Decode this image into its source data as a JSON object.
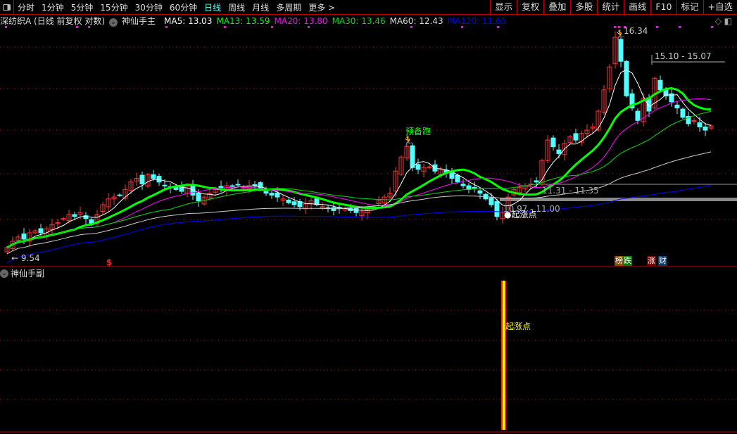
{
  "topbar": {
    "periods": [
      "分时",
      "1分钟",
      "5分钟",
      "15分钟",
      "30分钟",
      "60分钟",
      "日线",
      "周线",
      "月线",
      "多周期",
      "更多 >"
    ],
    "active": "日线",
    "buttons": [
      "显示",
      "复权",
      "叠加",
      "多股",
      "统计",
      "画线",
      "F10",
      "标记",
      "+自选"
    ]
  },
  "info": {
    "stock": "深纺织A (日线 前复权 对数)",
    "indicator": "神仙手主",
    "ma5": "MA5: 13.03",
    "ma13": "MA13: 13.59",
    "ma20": "MA20: 13.80",
    "ma30": "MA30: 13.46",
    "ma60": "MA60: 12.43",
    "ma120": "MA120: 11.65"
  },
  "colors": {
    "up": "#ff3232",
    "down": "#54ffff",
    "ma5": "#ffffff",
    "ma13": "#00ff00",
    "ma20": "#ff00ff",
    "ma30": "#00dd00",
    "ma60": "#cccccc",
    "ma120": "#0000ff",
    "grid": "#c00000"
  },
  "annotations": {
    "ready": "预备跑",
    "high": "16.34",
    "range1": "15.10 - 15.07",
    "range2": "11.31 - 11.35",
    "range3": "10.97 - 11.00",
    "start": "●起涨点",
    "low": "9.54",
    "dollar": "$",
    "tags": [
      "榜",
      "跌",
      "涨",
      "财"
    ]
  },
  "sub": {
    "title": "神仙手副",
    "signal": "起涨点"
  },
  "chart_data": {
    "type": "candlestick",
    "closes": [
      9.75,
      9.9,
      10.0,
      9.95,
      10.1,
      10.15,
      10.1,
      10.2,
      10.3,
      10.35,
      10.45,
      10.55,
      10.5,
      10.6,
      10.45,
      10.3,
      10.55,
      10.8,
      10.95,
      11.0,
      11.05,
      11.2,
      11.4,
      11.5,
      11.35,
      11.6,
      11.5,
      11.4,
      11.3,
      11.25,
      11.2,
      11.15,
      11.3,
      11.05,
      10.9,
      11.0,
      11.1,
      11.2,
      11.25,
      11.3,
      11.28,
      11.32,
      11.25,
      11.3,
      11.3,
      11.2,
      11.1,
      11.05,
      11.0,
      10.95,
      10.85,
      10.8,
      10.75,
      10.82,
      10.9,
      10.8,
      10.75,
      10.7,
      10.65,
      10.72,
      10.7,
      10.65,
      10.6,
      10.62,
      10.68,
      10.75,
      10.9,
      11.0,
      11.1,
      11.7,
      12.1,
      12.4,
      11.8,
      11.75,
      11.8,
      11.82,
      11.7,
      11.75,
      11.65,
      11.5,
      11.4,
      11.3,
      11.2,
      11.25,
      11.1,
      10.95,
      10.8,
      10.5,
      10.6,
      11.0,
      11.2,
      11.25,
      11.3,
      11.35,
      11.4,
      12.0,
      12.6,
      12.4,
      12.2,
      12.5,
      12.7,
      12.6,
      12.8,
      12.9,
      13.0,
      13.5,
      14.2,
      15.0,
      16.1,
      15.2,
      14.0,
      13.6,
      13.2,
      13.9,
      13.5,
      14.6,
      14.2,
      14.0,
      13.8,
      13.6,
      13.3,
      13.1,
      13.2,
      13.0,
      12.9,
      13.03
    ],
    "scale": "log",
    "high": 16.34,
    "low": 9.54,
    "ma_periods": [
      5,
      13,
      20,
      30,
      60,
      120
    ]
  }
}
